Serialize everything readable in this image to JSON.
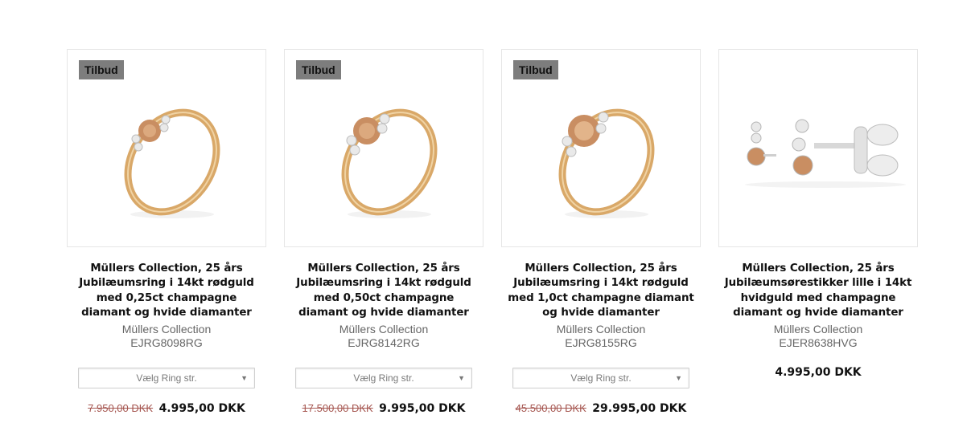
{
  "products": [
    {
      "badge": "Tilbud",
      "title": "Müllers Collection, 25 års Jubilæumsring i 14kt rødguld med 0,25ct champagne diamant og hvide diamanter",
      "brand": "Müllers Collection",
      "sku": "EJRG8098RG",
      "select_label": "Vælg Ring str.",
      "old_price": "7.950,00 DKK",
      "price": "4.995,00 DKK",
      "image": "rose-gold-ring-icon"
    },
    {
      "badge": "Tilbud",
      "title": "Müllers Collection, 25 års Jubilæumsring i 14kt rødguld med 0,50ct champagne diamant og hvide diamanter",
      "brand": "Müllers Collection",
      "sku": "EJRG8142RG",
      "select_label": "Vælg Ring str.",
      "old_price": "17.500,00 DKK",
      "price": "9.995,00 DKK",
      "image": "rose-gold-ring-icon"
    },
    {
      "badge": "Tilbud",
      "title": "Müllers Collection, 25 års Jubilæumsring i 14kt rødguld med 1,0ct champagne diamant og hvide diamanter",
      "brand": "Müllers Collection",
      "sku": "EJRG8155RG",
      "select_label": "Vælg Ring str.",
      "old_price": "45.500,00 DKK",
      "price": "29.995,00 DKK",
      "image": "rose-gold-ring-icon"
    },
    {
      "title": "Müllers Collection, 25 års Jubilæumsørestikker lille i 14kt hvidguld med champagne diamant og hvide diamanter",
      "brand": "Müllers Collection",
      "sku": "EJER8638HVG",
      "price": "4.995,00 DKK",
      "image": "white-gold-earrings-icon"
    }
  ],
  "colors": {
    "badge_bg": "#7d7d7d",
    "old_price": "#a5554f",
    "gold": "#d9a868",
    "champagne": "#c98e62"
  }
}
